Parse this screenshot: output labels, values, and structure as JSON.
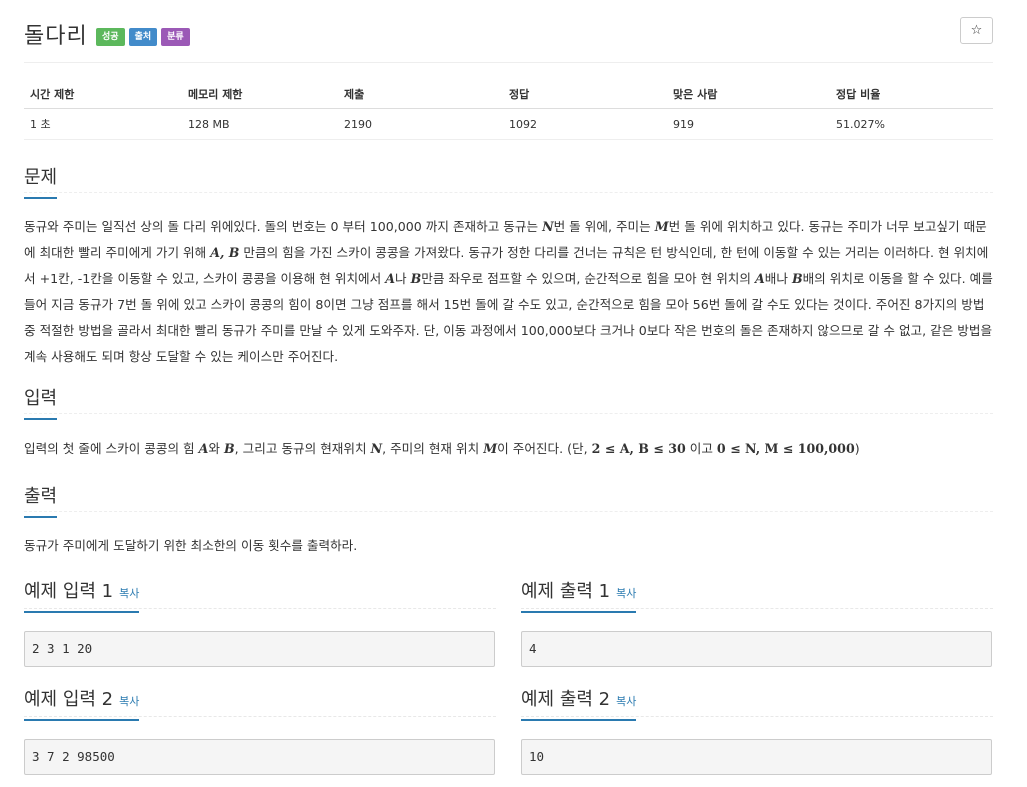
{
  "problem": {
    "title": "돌다리",
    "labels": {
      "success": "성공",
      "source": "출처",
      "category": "분류"
    },
    "star": "☆"
  },
  "info_table": {
    "headers": [
      "시간 제한",
      "메모리 제한",
      "제출",
      "정답",
      "맞은 사람",
      "정답 비율"
    ],
    "values": [
      "1 초",
      "128 MB",
      "2190",
      "1092",
      "919",
      "51.027%"
    ]
  },
  "sections": {
    "description": {
      "heading": "문제",
      "t1": "동규와 주미는 일직선 상의 돌 다리 위에있다. 돌의 번호는 0 부터 100,000 까지 존재하고 동규는 ",
      "v_N": "N",
      "t2": "번 돌 위에, 주미는 ",
      "v_M": "M",
      "t3": "번 돌 위에 위치하고 있다. 동규는 주미가 너무 보고싶기 때문에 최대한 빨리 주미에게 가기 위해 ",
      "v_AB": "A, B",
      "t4": " 만큼의 힘을 가진 스카이 콩콩을 가져왔다. 동규가 정한 다리를 건너는 규칙은 턴 방식인데, 한 턴에 이동할 수 있는 거리는 이러하다. 현 위치에서 +1칸, -1칸을 이동할 수 있고, 스카이 콩콩을 이용해 현 위치에서 ",
      "v_A1": "A",
      "t5": "나 ",
      "v_B1": "B",
      "t6": "만큼 좌우로 점프할 수 있으며, 순간적으로 힘을 모아 현 위치의 ",
      "v_A2": "A",
      "t7": "배나 ",
      "v_B2": "B",
      "t8": "배의 위치로 이동을 할 수 있다. 예를 들어 지금 동규가 7번 돌 위에 있고 스카이 콩콩의 힘이 8이면 그냥 점프를 해서 15번 돌에 갈 수도 있고, 순간적으로 힘을 모아 56번 돌에 갈 수도 있다는 것이다. 주어진 8가지의 방법 중 적절한 방법을 골라서 최대한 빨리 동규가 주미를 만날 수 있게 도와주자. 단, 이동 과정에서 100,000보다 크거나 0보다 작은 번호의 돌은 존재하지 않으므로 갈 수 없고, 같은 방법을 계속 사용해도 되며 항상 도달할 수 있는 케이스만 주어진다."
    },
    "input": {
      "heading": "입력",
      "t1": "입력의 첫 줄에 스카이 콩콩의 힘 ",
      "v_A": "A",
      "t2": "와 ",
      "v_B": "B",
      "t3": ", 그리고 동규의 현재위치 ",
      "v_N": "N",
      "t4": ", 주미의 현재 위치 ",
      "v_M": "M",
      "t5": "이 주어진다. (단, ",
      "range1": "2 ≤ A, B ≤ 30",
      "t6": " 이고 ",
      "range2": "0 ≤ N, M ≤ 100,000",
      "t7": ")"
    },
    "output": {
      "heading": "출력",
      "text": "동규가 주미에게 도달하기 위한 최소한의 이동 횟수를 출력하라."
    }
  },
  "samples": [
    {
      "title": "예제 입력 1",
      "copy": "복사",
      "content": "2 3 1 20"
    },
    {
      "title": "예제 출력 1",
      "copy": "복사",
      "content": "4"
    },
    {
      "title": "예제 입력 2",
      "copy": "복사",
      "content": "3 7 2 98500"
    },
    {
      "title": "예제 출력 2",
      "copy": "복사",
      "content": "10"
    }
  ]
}
